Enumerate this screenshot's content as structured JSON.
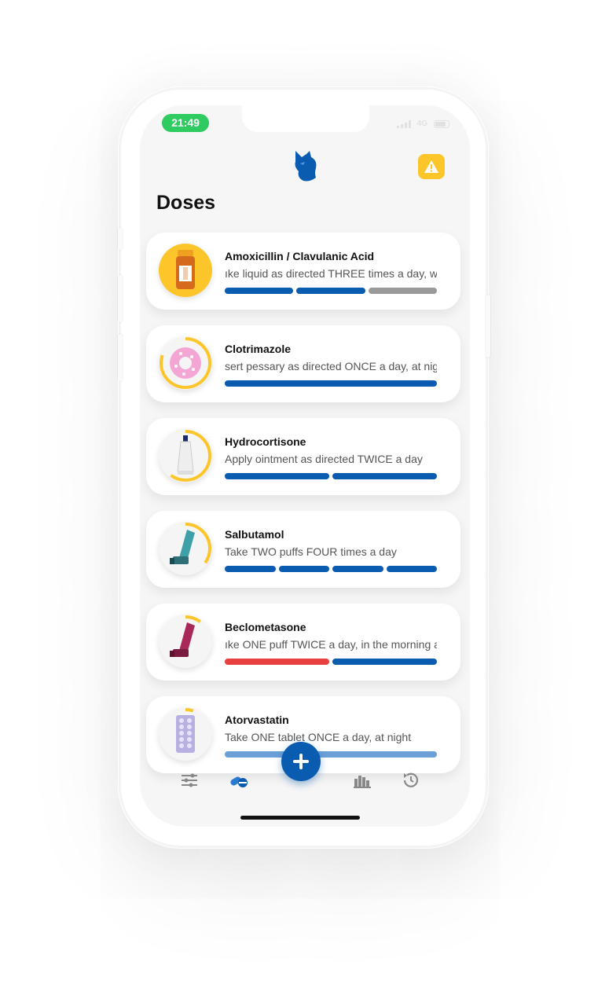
{
  "status_bar": {
    "time": "21:49",
    "network": "4G"
  },
  "header": {
    "title": "Doses",
    "logo_icon": "wolf-logo-icon",
    "alert_icon": "warning-icon"
  },
  "colors": {
    "accent": "#0a5cb0",
    "warning": "#fcc52a",
    "missed": "#e84040",
    "pending": "#9a9a9a",
    "status_green": "#2ecc60"
  },
  "doses": [
    {
      "name": "Amoxicillin / Clavulanic Acid",
      "instruction": "ıke liquid as directed THREE times a day, w",
      "icon": "medicine-bottle-icon",
      "bars": [
        "taken",
        "taken",
        "pending"
      ],
      "progress": 1.0
    },
    {
      "name": "Clotrimazole",
      "instruction": "sert pessary as directed ONCE a day, at nig",
      "icon": "pessary-ring-icon",
      "bars": [
        "taken"
      ],
      "progress": 0.8
    },
    {
      "name": "Hydrocortisone",
      "instruction": "Apply ointment as directed TWICE a day",
      "icon": "ointment-tube-icon",
      "bars": [
        "taken",
        "taken"
      ],
      "progress": 0.6
    },
    {
      "name": "Salbutamol",
      "instruction": "Take TWO puffs FOUR times a day",
      "icon": "inhaler-icon",
      "bars": [
        "taken",
        "taken",
        "taken",
        "taken"
      ],
      "progress": 0.35
    },
    {
      "name": "Beclometasone",
      "instruction": "ıke ONE puff TWICE a day, in the morning a",
      "icon": "inhaler-icon",
      "bars": [
        "missed",
        "taken"
      ],
      "progress": 0.1
    },
    {
      "name": "Atorvastatin",
      "instruction": "Take ONE tablet ONCE a day, at night",
      "icon": "blister-pack-icon",
      "bars": [
        "taken-light"
      ],
      "progress": 0.05
    }
  ],
  "tabbar": [
    {
      "name": "settings",
      "icon": "sliders-icon"
    },
    {
      "name": "doses",
      "icon": "pills-icon"
    },
    {
      "name": "add",
      "icon": "plus-icon"
    },
    {
      "name": "stats",
      "icon": "bar-chart-icon"
    },
    {
      "name": "history",
      "icon": "history-icon"
    }
  ]
}
